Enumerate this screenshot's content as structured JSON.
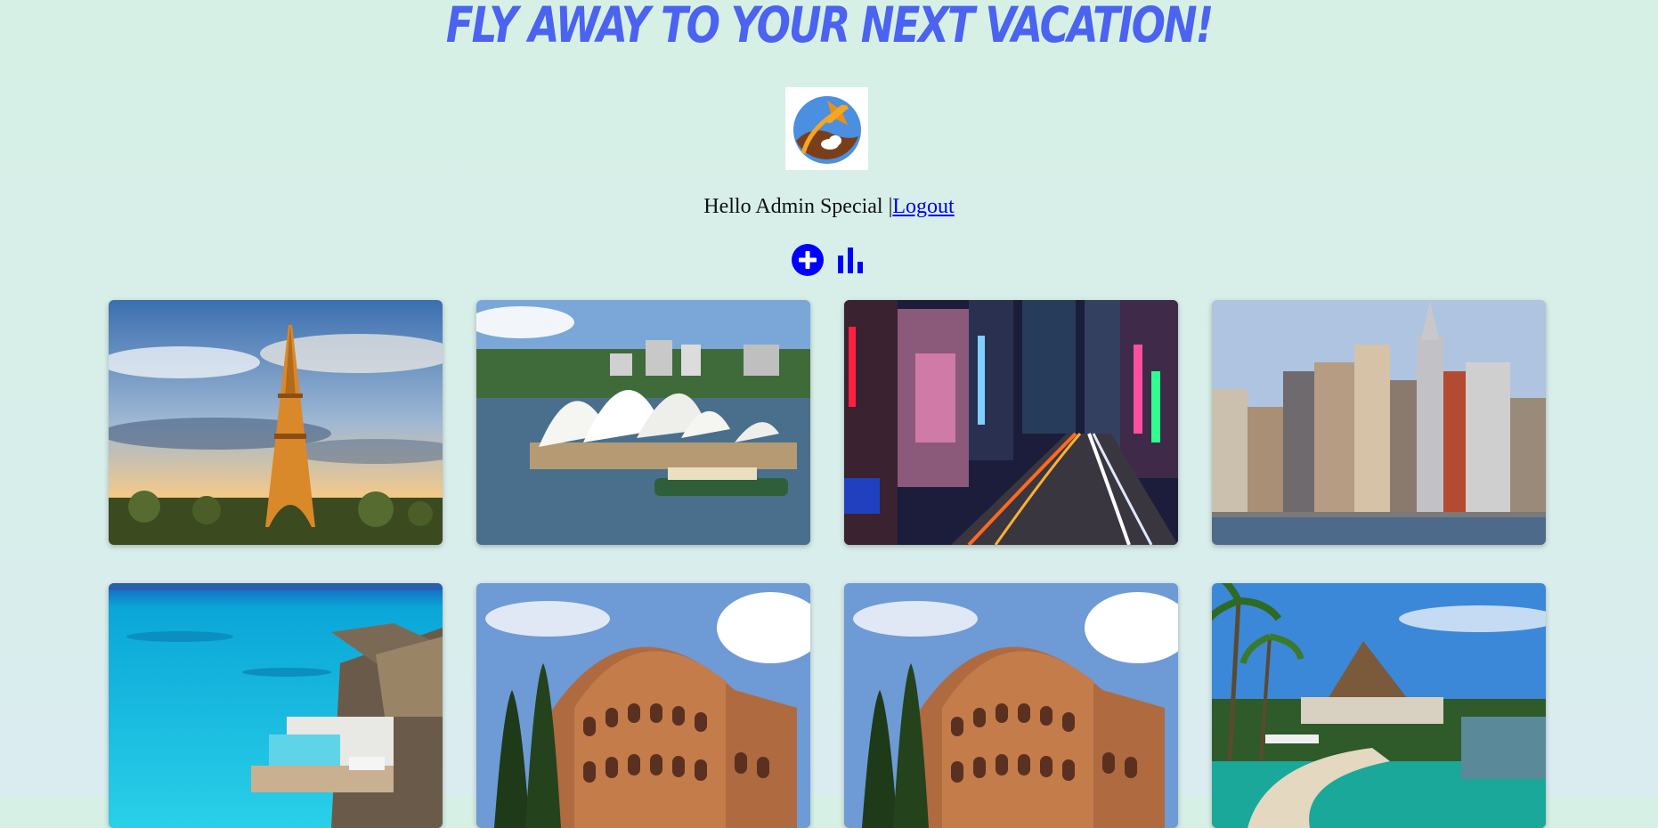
{
  "header": {
    "title": "FLY AWAY TO YOUR NEXT VACATION!",
    "title_color": "#4b63f0"
  },
  "logo": {
    "icon": "plane-globe-logo-icon"
  },
  "user": {
    "greeting": "Hello Admin Special |",
    "logout_label": "Logout"
  },
  "actions": {
    "add_icon": "add-circle-icon",
    "stats_icon": "bar-chart-icon",
    "color": "#0000ff"
  },
  "destinations": [
    {
      "scene": "eiffel-tower-paris"
    },
    {
      "scene": "sydney-opera-house"
    },
    {
      "scene": "tokyo-night-street"
    },
    {
      "scene": "new-york-skyline"
    },
    {
      "scene": "overwater-bungalow-lagoon"
    },
    {
      "scene": "colosseum-rome"
    },
    {
      "scene": "colosseum-rome"
    },
    {
      "scene": "tropical-resort-pool"
    }
  ]
}
